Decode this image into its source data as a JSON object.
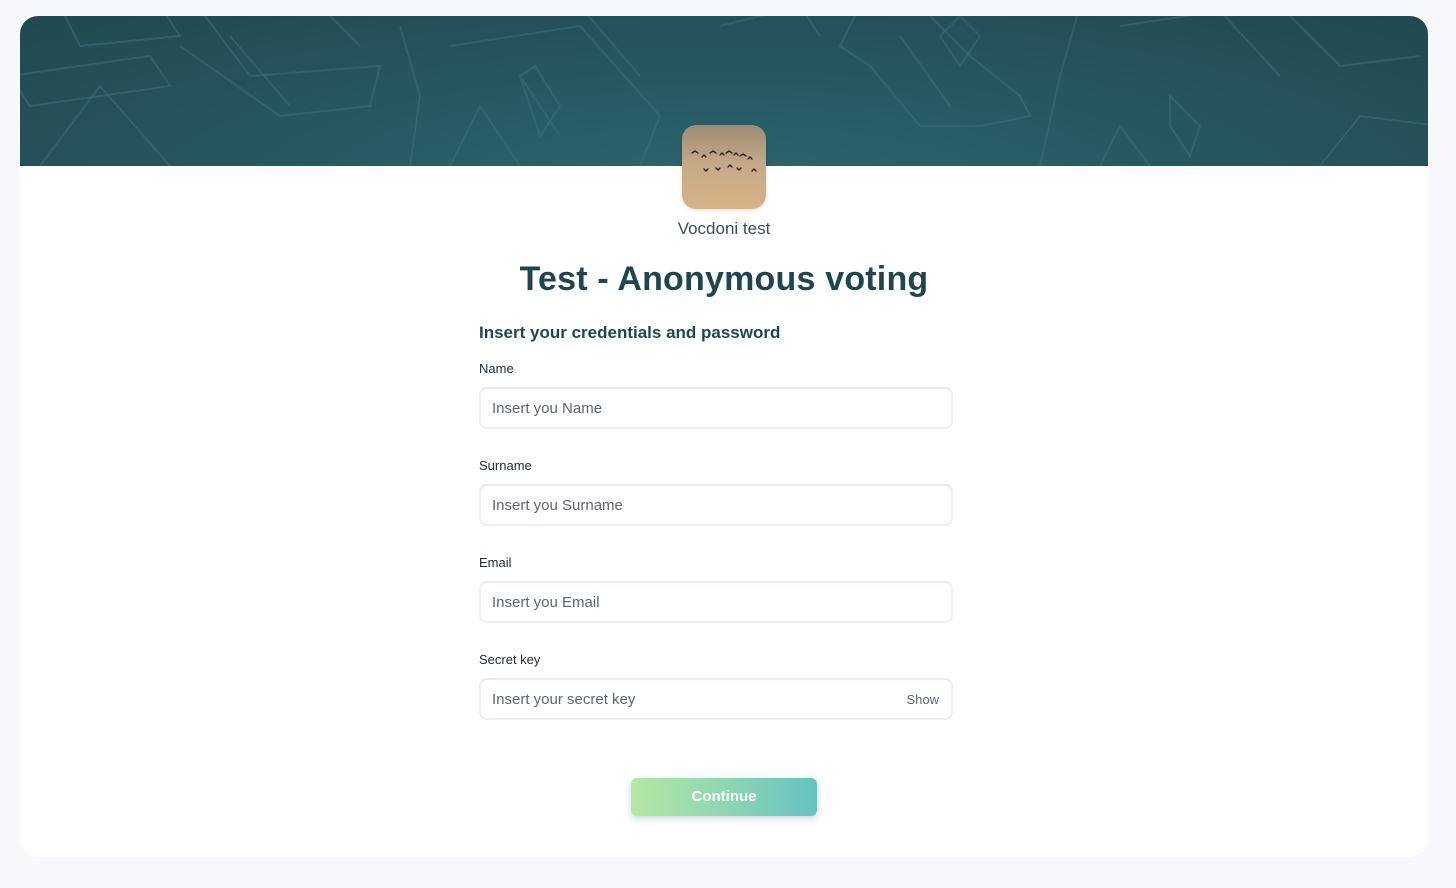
{
  "organization": {
    "name": "Vocdoni test",
    "logo_icon": "flock-of-birds-sky-image"
  },
  "process": {
    "title": "Test - Anonymous voting"
  },
  "form": {
    "heading": "Insert your credentials and password",
    "fields": [
      {
        "label": "Name",
        "placeholder": "Insert you Name",
        "value": ""
      },
      {
        "label": "Surname",
        "placeholder": "Insert you Surname",
        "value": ""
      },
      {
        "label": "Email",
        "placeholder": "Insert you Email",
        "value": ""
      },
      {
        "label": "Secret key",
        "placeholder": "Insert your secret key",
        "value": "",
        "toggle_label": "Show"
      }
    ],
    "submit_label": "Continue"
  },
  "colors": {
    "banner": "#275a64",
    "title": "#1f4650",
    "button_gradient_start": "#b5e8a3",
    "button_gradient_end": "#66c2c1",
    "page_background": "#f7f8fc"
  }
}
